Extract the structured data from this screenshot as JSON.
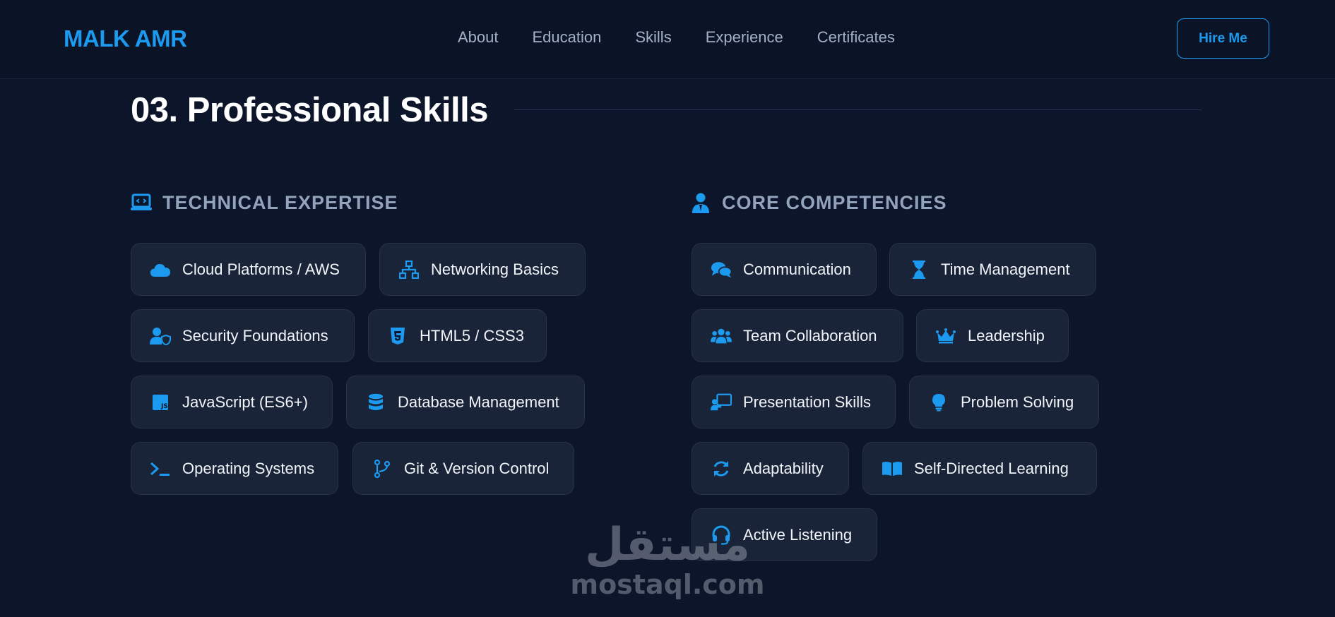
{
  "nav": {
    "logo": "MALK AMR",
    "links": [
      "About",
      "Education",
      "Skills",
      "Experience",
      "Certificates"
    ],
    "cta": "Hire Me"
  },
  "section": {
    "title": "03. Professional Skills"
  },
  "technical": {
    "header": "TECHNICAL EXPERTISE",
    "header_icon": "laptop-code-icon",
    "items": [
      {
        "label": "Cloud Platforms / AWS",
        "icon": "cloud-icon"
      },
      {
        "label": "Networking Basics",
        "icon": "network-icon"
      },
      {
        "label": "Security Foundations",
        "icon": "user-shield-icon"
      },
      {
        "label": "HTML5 / CSS3",
        "icon": "html5-icon"
      },
      {
        "label": "JavaScript (ES6+)",
        "icon": "js-icon"
      },
      {
        "label": "Database Management",
        "icon": "database-icon"
      },
      {
        "label": "Operating Systems",
        "icon": "terminal-icon"
      },
      {
        "label": "Git & Version Control",
        "icon": "git-branch-icon"
      }
    ]
  },
  "core": {
    "header": "CORE COMPETENCIES",
    "header_icon": "user-tie-icon",
    "items": [
      {
        "label": "Communication",
        "icon": "comments-icon"
      },
      {
        "label": "Time Management",
        "icon": "hourglass-icon"
      },
      {
        "label": "Team Collaboration",
        "icon": "users-icon"
      },
      {
        "label": "Leadership",
        "icon": "crown-icon"
      },
      {
        "label": "Presentation Skills",
        "icon": "presentation-icon"
      },
      {
        "label": "Problem Solving",
        "icon": "lightbulb-icon"
      },
      {
        "label": "Adaptability",
        "icon": "sync-icon"
      },
      {
        "label": "Self-Directed Learning",
        "icon": "book-open-icon"
      },
      {
        "label": "Active Listening",
        "icon": "headset-icon"
      }
    ]
  },
  "watermark": {
    "arabic": "مستقل",
    "latin": "mostaql.com"
  },
  "colors": {
    "accent": "#1b9af0",
    "background": "#0c1529",
    "card": "#1a2438",
    "header_text": "#93a3bb"
  }
}
